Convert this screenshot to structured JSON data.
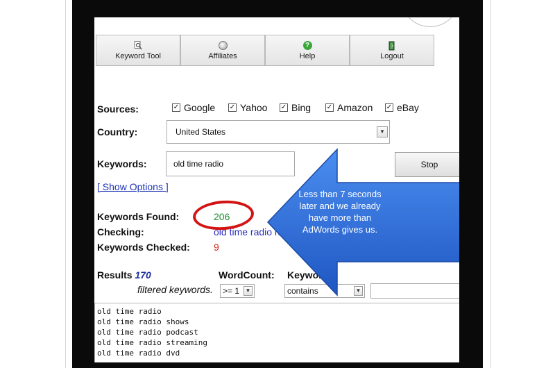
{
  "toolbar": {
    "keyword_tool": "Keyword Tool",
    "affiliates": "Affiliates",
    "help": "Help",
    "logout": "Logout",
    "help_glyph": "?"
  },
  "sources": {
    "label": "Sources:",
    "items": [
      {
        "name": "Google",
        "checked": true
      },
      {
        "name": "Yahoo",
        "checked": true
      },
      {
        "name": "Bing",
        "checked": true
      },
      {
        "name": "Amazon",
        "checked": true
      },
      {
        "name": "eBay",
        "checked": true
      }
    ]
  },
  "country": {
    "label": "Country:",
    "value": "United States"
  },
  "keywords": {
    "label": "Keywords:",
    "value": "old time radio"
  },
  "stop_button": "Stop",
  "show_options": "[ Show Options ]",
  "stats": {
    "found_label": "Keywords Found:",
    "found_value": "206",
    "checking_label": "Checking:",
    "checking_value": "old time radio h",
    "checked_label": "Keywords Checked:",
    "checked_value": "9"
  },
  "callout": "Less than 7 seconds later and we already have more than AdWords gives us.",
  "results": {
    "label": "Results",
    "count": "170",
    "filtered_text": "filtered keywords.",
    "wordcount_label": "WordCount:",
    "wordcount_value": ">= 1",
    "keyword_label": "Keyword",
    "keyword_filter": "contains"
  },
  "output_lines": [
    "old time radio",
    "old time radio shows",
    "old time radio podcast",
    "old time radio streaming",
    "old time radio dvd"
  ],
  "colors": {
    "found_green": "#1f8f2f",
    "checked_red": "#d22b1b",
    "link_blue": "#1d33b3",
    "callout_blue": "#2a67d6",
    "ring_red": "#d21414"
  }
}
